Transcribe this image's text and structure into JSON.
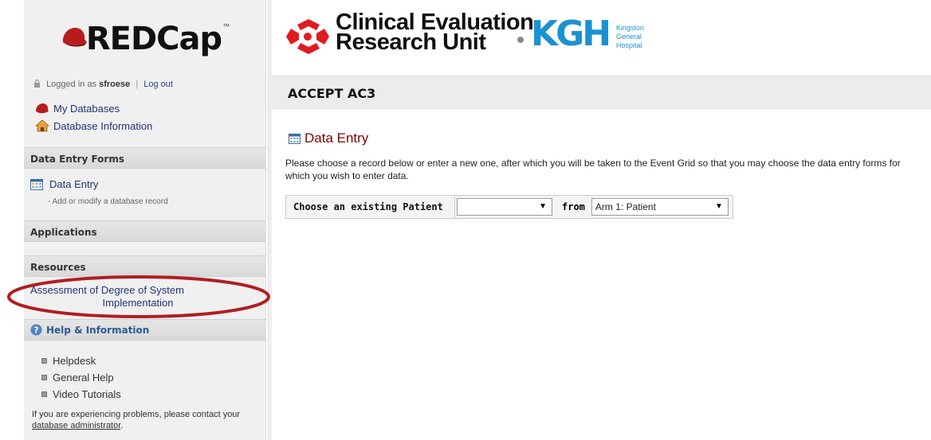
{
  "app": {
    "name": "REDCap",
    "tm": "™"
  },
  "user": {
    "prefix": "Logged in as",
    "name": "sfroese",
    "logout": "Log out"
  },
  "nav": {
    "my_databases": "My Databases",
    "database_info": "Database Information"
  },
  "sections": {
    "data_entry_forms": "Data Entry Forms",
    "applications": "Applications",
    "resources": "Resources",
    "help": "Help & Information"
  },
  "data_entry": {
    "link": "Data Entry",
    "sub": "- Add or modify a database record"
  },
  "resources": {
    "line1": "Assessment of Degree of System",
    "line2": "Implementation"
  },
  "help_items": [
    "Helpdesk",
    "General Help",
    "Video Tutorials"
  ],
  "contact": {
    "text": "If you are experiencing problems, please contact your",
    "link": "database administrator",
    "end": "."
  },
  "header": {
    "cru_line1": "Clinical Evaluation",
    "cru_line2": "Research Unit",
    "kgh": "KGH",
    "kgh_sub1": "Kingston",
    "kgh_sub2": "General",
    "kgh_sub3": "Hospital"
  },
  "project": {
    "title": "ACCEPT AC3"
  },
  "main": {
    "section_title": "Data Entry",
    "instructions": "Please choose a record below or enter a new one, after which you will be taken to the Event Grid so that you may choose the data entry forms for which you wish to enter data.",
    "choose_label": "Choose an existing Patient",
    "patient_value": "",
    "from_label": "from",
    "arm_value": "Arm 1: Patient"
  },
  "colors": {
    "accent_red": "#800000",
    "link": "#223377",
    "kgh_blue": "#1a91d1",
    "highlight_oval": "#b01d22"
  }
}
